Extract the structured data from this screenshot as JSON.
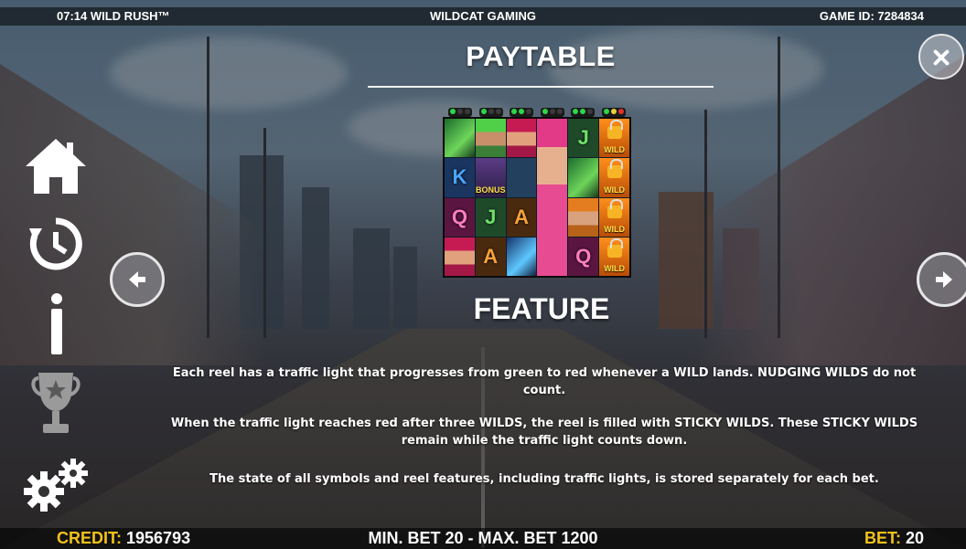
{
  "top_bar": {
    "left": "07:14 WILD RUSH™",
    "center": "WILDCAT GAMING",
    "right": "GAME ID: 7284834"
  },
  "paytable": {
    "title": "PAYTABLE",
    "feature_heading": "FEATURE",
    "paragraphs": [
      "Each reel has a traffic light that progresses from green to red whenever a WILD lands. NUDGING WILDS do not count.",
      "When the traffic light reaches red after three WILDS, the reel is filled with STICKY WILDS. These STICKY WILDS remain while the traffic light counts down.",
      "The state of all symbols and reel features, including traffic lights, is stored separately for each bet."
    ]
  },
  "reel_preview": {
    "symbol_letters": {
      "j": "J",
      "k": "K",
      "q": "Q",
      "a": "A"
    },
    "wild_label": "WILD",
    "bonus_label": "BONUS"
  },
  "side_menu": [
    "home-icon",
    "history-icon",
    "info-icon",
    "trophy-icon",
    "settings-icon"
  ],
  "bottom_bar": {
    "credit_label": "CREDIT:",
    "credit_value": "1956793",
    "limits": "MIN. BET 20 - MAX. BET 1200",
    "bet_label": "BET:",
    "bet_value": "20"
  },
  "colors": {
    "accent_yellow": "#f2c21b",
    "wild_orange": "#ff8f1c",
    "light_green": "#2fd54a",
    "light_red": "#e53131"
  }
}
